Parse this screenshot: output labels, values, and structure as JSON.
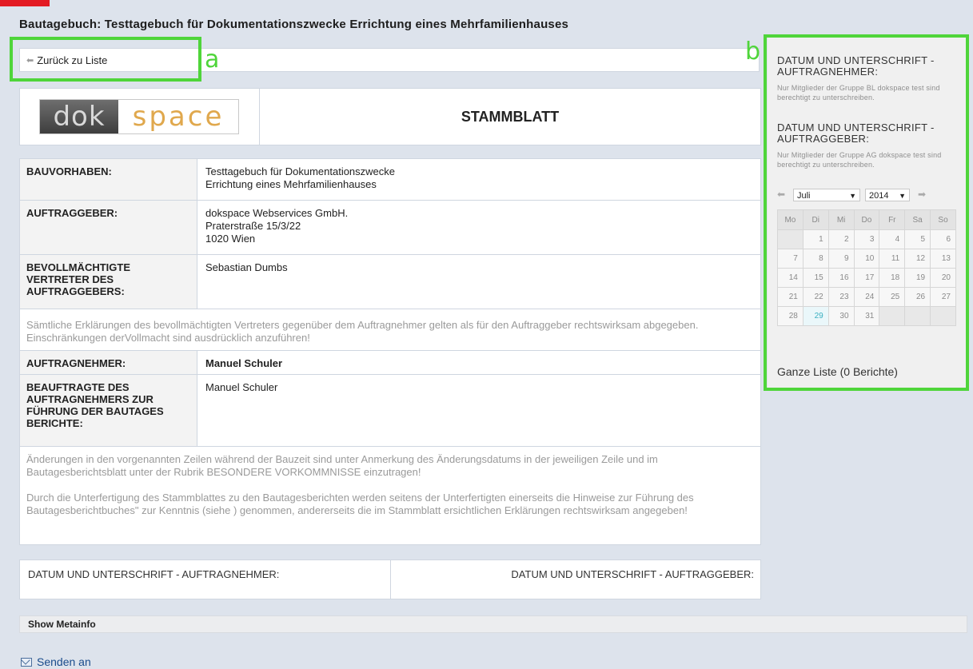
{
  "page": {
    "title": "Bautagebuch: Testtagebuch für Dokumentationszwecke Errichtung eines Mehrfamilienhauses",
    "back_label": "Zurück zu Liste"
  },
  "annotations": {
    "a": "a",
    "b": "b"
  },
  "header": {
    "logo_left": "dok",
    "logo_right": "space",
    "heading": "STAMMBLATT"
  },
  "rows": [
    {
      "label": "BAUVORHABEN:",
      "value": "Testtagebuch für Dokumentationszwecke\nErrichtung eines Mehrfamilienhauses"
    },
    {
      "label": "AUFTRAGGEBER:",
      "value": "dokspace Webservices GmbH.\nPraterstraße 15/3/22\n1020 Wien"
    },
    {
      "label": "BEVOLLMÄCHTIGTE VERTRETER DES AUFTRAGGEBERS:",
      "value": "Sebastian Dumbs"
    },
    {
      "label": "AUFTRAGNEHMER:",
      "value": "Manuel Schuler"
    },
    {
      "label": "BEAUFTRAGTE DES AUFTRAGNEHMERS ZUR FÜHRUNG DER BAUTAGES BERICHTE:",
      "value": "Manuel Schuler"
    }
  ],
  "notes": {
    "vollmacht": "Sämtliche Erklärungen des bevollmächtigten Vertreters gegenüber dem Auftragnehmer gelten als für den Auftraggeber rechtswirksam abgegeben. Einschränkungen derVollmacht sind ausdrücklich anzuführen!",
    "aenderungen": "Änderungen in den vorgenannten Zeilen während der Bauzeit sind unter Anmerkung des Änderungsdatums in der jeweiligen Zeile und im Bautagesberichtsblatt unter der Rubrik BESONDERE VORKOMMNISSE einzutragen!",
    "unterfertigung": "Durch die Unterfertigung des Stammblattes zu den Bautagesberichten werden seitens der Unterfertigten einerseits die Hinweise zur Führung des Bautagesberichtbuches\" zur Kenntnis (siehe ) genommen, andererseits die im Stammblatt ersichtlichen Erklärungen rechtswirksam angegeben!"
  },
  "signature": {
    "left": "DATUM UND UNTERSCHRIFT - AUFTRAGNEHMER:",
    "right": "DATUM UND UNTERSCHRIFT - AUFTRAGGEBER:"
  },
  "meta_label": "Show Metainfo",
  "send_label": "Senden an",
  "sidebar": {
    "an_title": "DATUM UND UNTERSCHRIFT - AUFTRAGNEHMER:",
    "an_hint": "Nur Mitglieder der Gruppe BL dokspace test sind berechtigt zu unterschreiben.",
    "ag_title": "DATUM UND UNTERSCHRIFT - AUFTRAGGEBER:",
    "ag_hint": "Nur Mitglieder der Gruppe AG dokspace test sind berechtigt zu unterschreiben.",
    "month": "Juli",
    "year": "2014",
    "weekdays": [
      "Mo",
      "Di",
      "Mi",
      "Do",
      "Fr",
      "Sa",
      "So"
    ],
    "weeks": [
      [
        "",
        "1",
        "2",
        "3",
        "4",
        "5",
        "6"
      ],
      [
        "7",
        "8",
        "9",
        "10",
        "11",
        "12",
        "13"
      ],
      [
        "14",
        "15",
        "16",
        "17",
        "18",
        "19",
        "20"
      ],
      [
        "21",
        "22",
        "23",
        "24",
        "25",
        "26",
        "27"
      ],
      [
        "28",
        "29",
        "30",
        "31",
        "",
        "",
        ""
      ]
    ],
    "today": "29",
    "all_list": "Ganze Liste (0 Berichte)"
  },
  "colors": {
    "annotation": "#4fd53a",
    "corner": "#e31b23",
    "link": "#1a4c8c",
    "today": "#3bb0c0"
  }
}
